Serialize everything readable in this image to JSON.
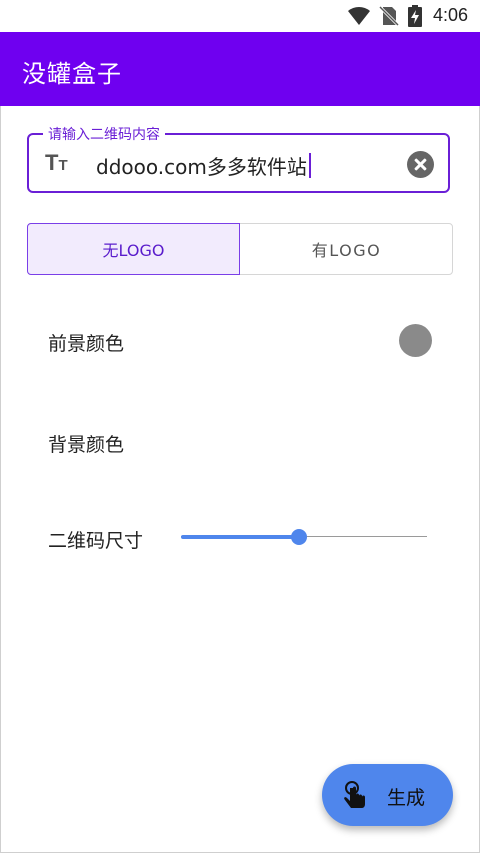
{
  "status_bar": {
    "time": "4:06",
    "icons": [
      "wifi-icon",
      "no-sim-icon",
      "battery-charging-icon"
    ]
  },
  "app_bar": {
    "title": "没罐盒子"
  },
  "qr_input": {
    "label": "请输入二维码内容",
    "value": "ddooo.com多多软件站",
    "leading_icon": "text-fields-icon",
    "trailing_icon": "clear-icon"
  },
  "logo_toggle": {
    "options": [
      "无LOGO",
      "有LOGO"
    ],
    "selected": "无LOGO"
  },
  "settings": {
    "foreground_color": {
      "label": "前景颜色",
      "value_color": "#8a8a8a"
    },
    "background_color": {
      "label": "背景颜色"
    },
    "qr_size": {
      "label": "二维码尺寸",
      "slider_fraction": 0.48
    }
  },
  "fab": {
    "label": "生成",
    "icon": "tap-icon"
  },
  "colors": {
    "primary": "#6f00f0",
    "accent": "#4f86ec",
    "outline": "#6a1fd6"
  }
}
